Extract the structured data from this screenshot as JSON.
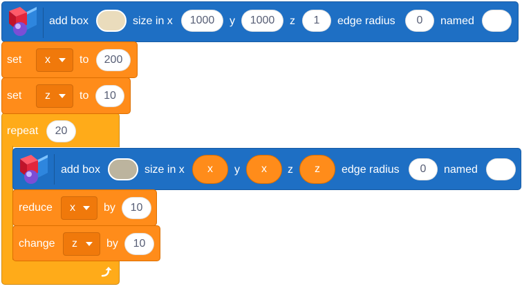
{
  "block1": {
    "label_add_box": "add box",
    "color": "#eadcbc",
    "label_size_in_x": "size in x",
    "x_value": "1000",
    "label_y": "y",
    "y_value": "1000",
    "label_z": "z",
    "z_value": "1",
    "label_edge_radius": "edge radius",
    "edge_radius_value": "0",
    "label_named": "named",
    "named_value": ""
  },
  "set_x": {
    "label_set": "set",
    "variable": "x",
    "label_to": "to",
    "value": "200"
  },
  "set_z": {
    "label_set": "set",
    "variable": "z",
    "label_to": "to",
    "value": "10"
  },
  "repeat": {
    "label": "repeat",
    "count": "20",
    "loop_icon": "loop-arrow-icon"
  },
  "block2": {
    "label_add_box": "add box",
    "color": "#bcb49e",
    "label_size_in_x": "size in x",
    "x_value": "x",
    "label_y": "y",
    "y_value": "x",
    "label_z": "z",
    "z_value": "z",
    "label_edge_radius": "edge radius",
    "edge_radius_value": "0",
    "label_named": "named",
    "named_value": ""
  },
  "reduce": {
    "label": "reduce",
    "variable": "x",
    "label_by": "by",
    "value": "10"
  },
  "change": {
    "label": "change",
    "variable": "z",
    "label_by": "by",
    "value": "10"
  },
  "colors": {
    "extension_blue": "#1e6fc4",
    "variables_orange": "#ff8c1a",
    "control_yellow": "#ffab19"
  }
}
